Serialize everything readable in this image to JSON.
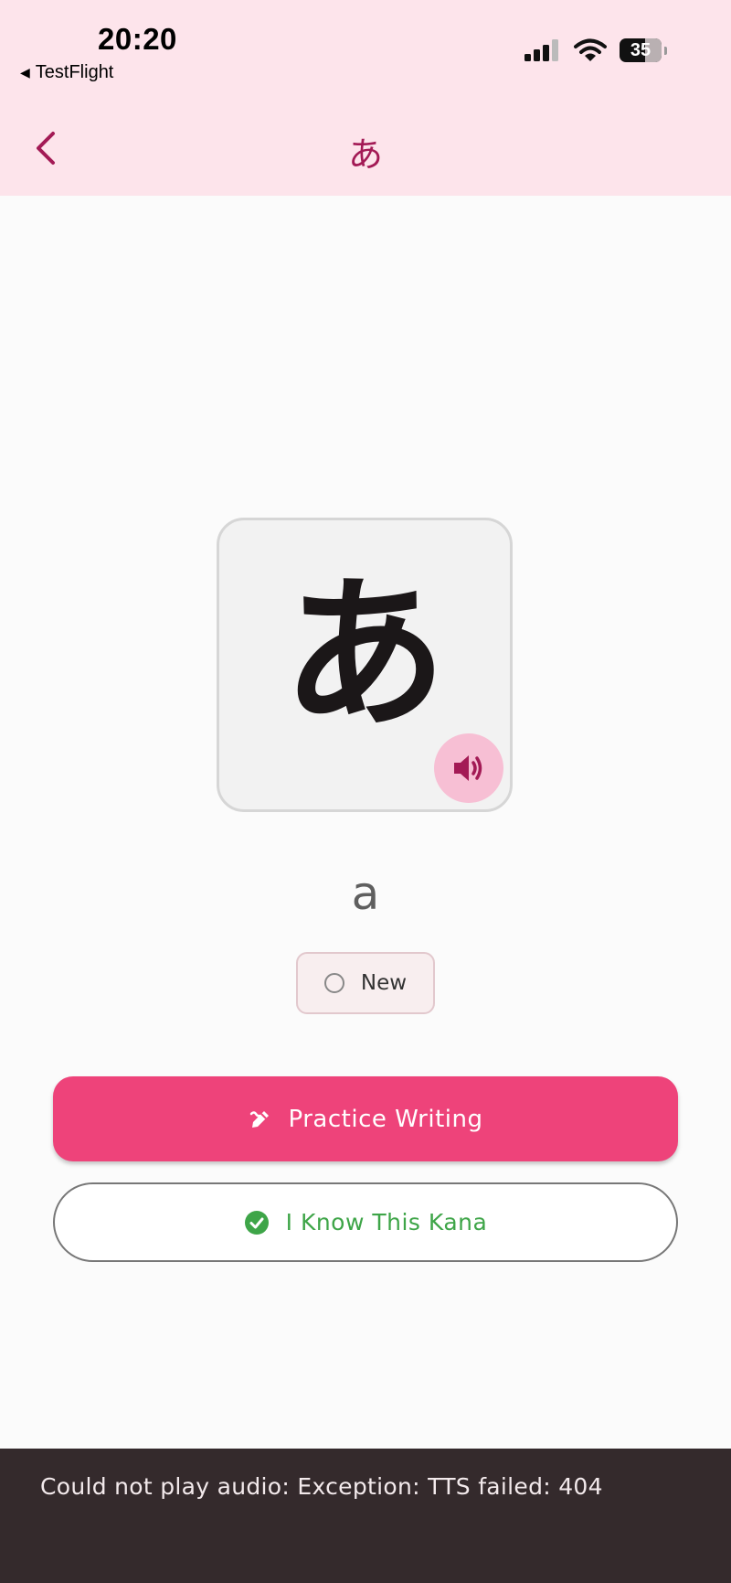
{
  "status_bar": {
    "time": "20:20",
    "back_app": "TestFlight",
    "battery": "35"
  },
  "nav": {
    "title": "あ"
  },
  "kana": {
    "character": "あ",
    "romaji": "a"
  },
  "status_chip": {
    "label": "New"
  },
  "actions": {
    "practice_label": "Practice Writing",
    "know_label": "I Know This Kana"
  },
  "snackbar": {
    "message": "Could not play audio: Exception: TTS failed: 404"
  },
  "colors": {
    "header_bg": "#fde4eb",
    "accent": "#a31a55",
    "primary_button": "#ee437a",
    "success": "#3ea548",
    "snackbar_bg": "#342a2c"
  },
  "icons": {
    "back": "chevron-left-icon",
    "audio": "volume-icon",
    "practice": "pencil-icon",
    "know": "check-circle-icon"
  }
}
